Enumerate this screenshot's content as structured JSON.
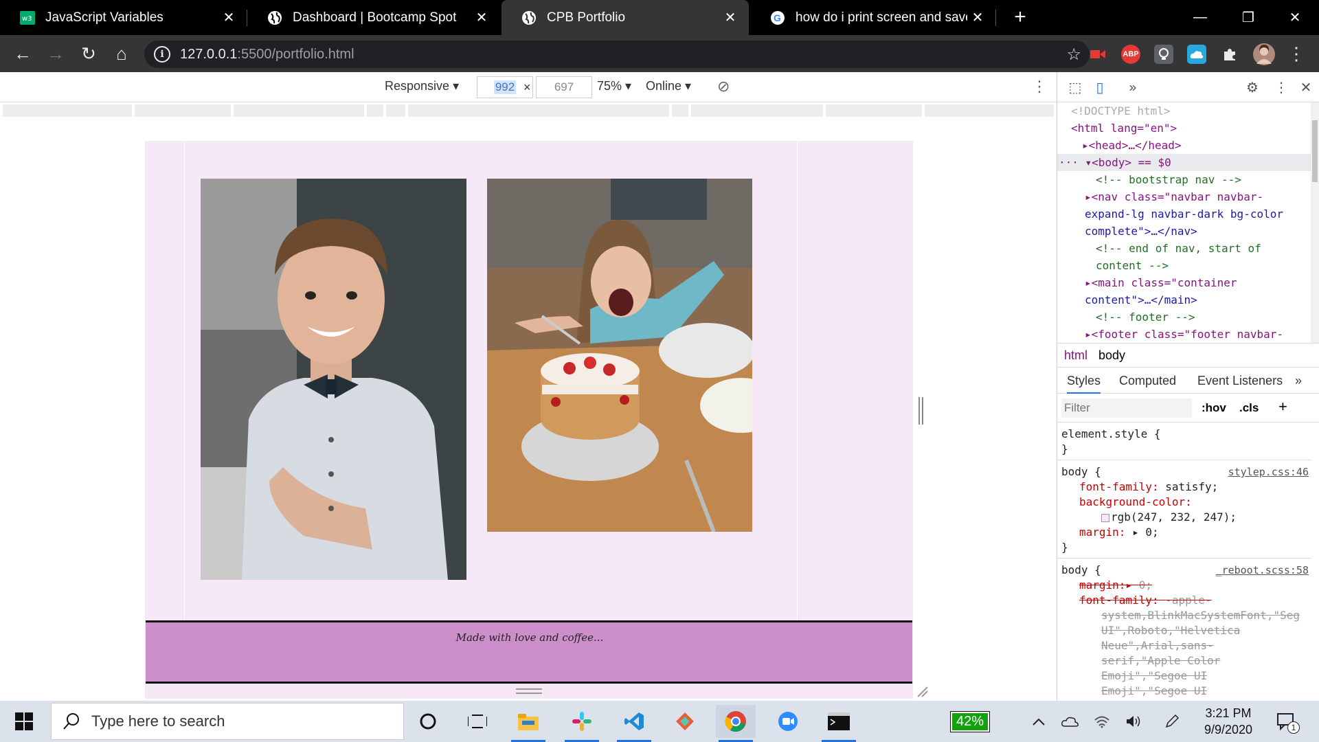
{
  "browser": {
    "tabs": [
      {
        "title": "JavaScript Variables",
        "favicon": "w3-icon",
        "active": false
      },
      {
        "title": "Dashboard | Bootcamp Spot",
        "favicon": "globe-icon",
        "active": false
      },
      {
        "title": "CPB Portfolio",
        "favicon": "globe-icon",
        "active": true
      },
      {
        "title": "how do i print screen and save to",
        "favicon": "google-icon",
        "active": false
      }
    ],
    "new_tab_label": "+",
    "url_host": "127.0.0.1",
    "url_rest": ":5500/portfolio.html",
    "extensions": [
      "camera-ext-icon",
      "ABP",
      "bulb-ext-icon",
      "cloud-ext-icon",
      "puzzle-icon",
      "avatar"
    ]
  },
  "device_toolbar": {
    "mode": "Responsive",
    "width": "992",
    "times": "×",
    "height": "697",
    "zoom": "75%",
    "network": "Online"
  },
  "page": {
    "footer_text": "Made with love and coffee...",
    "photo1": "Smiling boy in white shirt with bow tie",
    "photo2": "Girl with strawberry cream cake"
  },
  "devtools": {
    "elements": [
      {
        "kind": "doctype",
        "text": "<!DOCTYPE html>"
      },
      {
        "kind": "open",
        "text": "<html lang=\"en\">"
      },
      {
        "kind": "collapsed",
        "text": "<head>…</head>"
      },
      {
        "kind": "selected",
        "text": "<body> == $0"
      },
      {
        "kind": "comment",
        "text": "<!-- bootstrap nav -->"
      },
      {
        "kind": "node",
        "text": "<nav class=\"navbar navbar-"
      },
      {
        "kind": "cont",
        "text": "expand-lg navbar-dark bg-color"
      },
      {
        "kind": "cont",
        "text": "complete\">…</nav>"
      },
      {
        "kind": "comment",
        "text": "<!-- end of nav, start of"
      },
      {
        "kind": "comment-cont",
        "text": "content -->"
      },
      {
        "kind": "node",
        "text": "<main class=\"container"
      },
      {
        "kind": "cont",
        "text": "content\">…</main>"
      },
      {
        "kind": "comment",
        "text": "<!-- footer -->"
      },
      {
        "kind": "node",
        "text": "<footer class=\"footer navbar-"
      }
    ],
    "breadcrumbs": [
      "html",
      "body"
    ],
    "subtabs": [
      "Styles",
      "Computed",
      "Event Listeners"
    ],
    "filter_placeholder": "Filter",
    "hov": ":hov",
    "cls": ".cls",
    "plus": "+",
    "element_style": "element.style {",
    "close_brace": "}",
    "rule1": {
      "selector": "body {",
      "source": "stylep.css:46",
      "font_family_name": "font-family",
      "font_family_value": "satisfy;",
      "bg_name": "background-color",
      "bg_value": "rgb(247, 232, 247);",
      "margin_name": "margin",
      "margin_value": "0;"
    },
    "rule2": {
      "selector": "body {",
      "source": "_reboot.scss:58",
      "margin_name": "margin",
      "margin_value": "0;",
      "font_family_name": "font-family",
      "font_family_lines": [
        "-apple-",
        "system,BlinkMacSystemFont,\"Seg",
        "UI\",Roboto,\"Helvetica",
        "Neue\",Arial,sans-",
        "serif,\"Apple Color",
        "Emoji\",\"Segoe UI",
        "Emoji\",\"Segoe UI"
      ]
    }
  },
  "taskbar": {
    "search_placeholder": "Type here to search",
    "battery": "42%",
    "time": "3:21 PM",
    "date": "9/9/2020",
    "notifications": "1"
  },
  "colors": {
    "page_bg": "#f7e8f7",
    "footer_bg": "#cc8fcc"
  }
}
